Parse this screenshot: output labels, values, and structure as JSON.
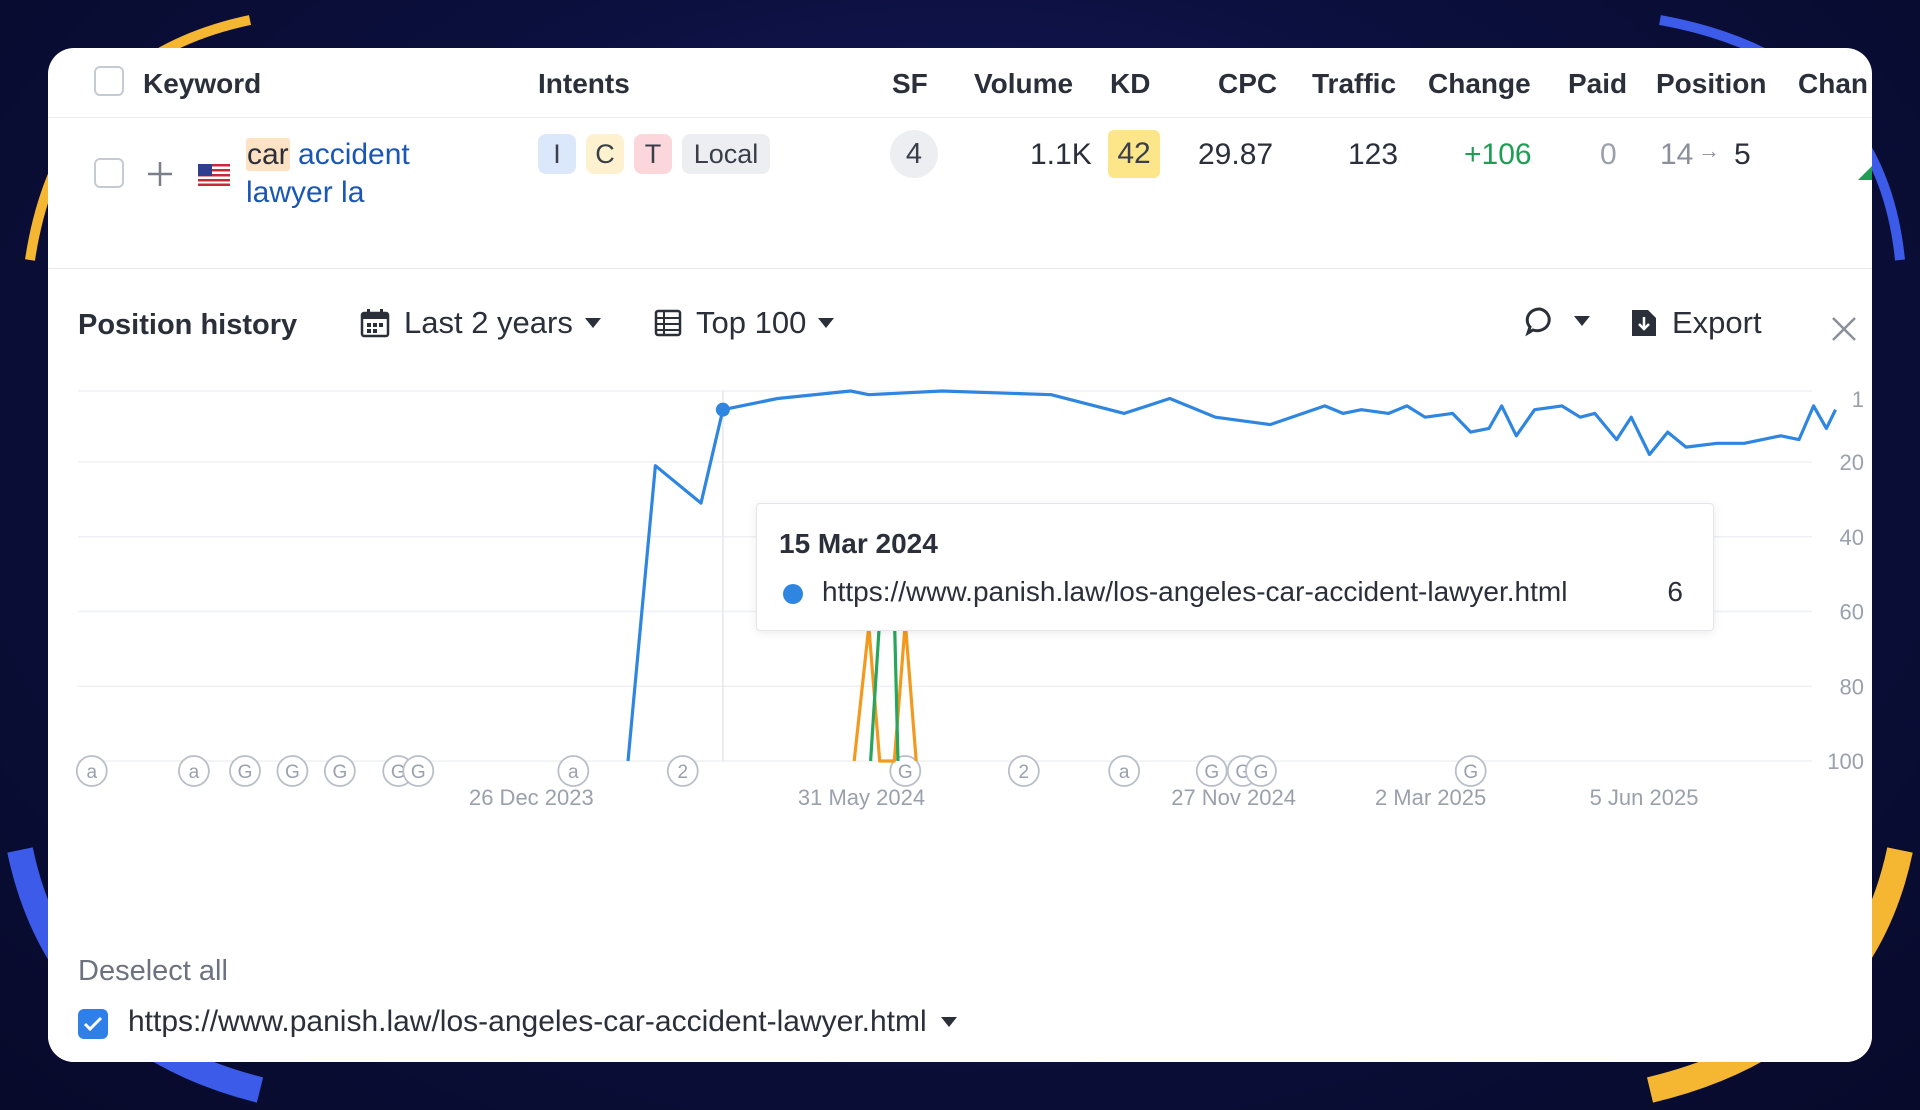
{
  "table": {
    "headers": {
      "keyword": "Keyword",
      "intents": "Intents",
      "sf": "SF",
      "volume": "Volume",
      "kd": "KD",
      "cpc": "CPC",
      "traffic": "Traffic",
      "change": "Change",
      "paid": "Paid",
      "position": "Position",
      "change2": "Chan"
    },
    "row": {
      "keyword_highlight": "car",
      "keyword_rest_line1": " accident",
      "keyword_line2": "lawyer la",
      "intents": [
        "I",
        "C",
        "T",
        "Local"
      ],
      "sf": "4",
      "volume": "1.1K",
      "kd": "42",
      "cpc": "29.87",
      "traffic": "123",
      "change": "+106",
      "paid": "0",
      "position_from": "14",
      "position_arrow": "→",
      "position_to": "5"
    }
  },
  "history": {
    "title": "Position history",
    "period": "Last 2 years",
    "top": "Top 100",
    "export": "Export",
    "deselect_all": "Deselect all",
    "url": "https://www.panish.law/los-angeles-car-accident-lawyer.html"
  },
  "tooltip": {
    "date": "15 Mar 2024",
    "url": "https://www.panish.law/los-angeles-car-accident-lawyer.html",
    "value": "6"
  },
  "colors": {
    "accent_blue": "#2f86e0",
    "kd_yellow": "#fde68a",
    "change_green": "#1f9d55",
    "orange_series": "#f39a1e",
    "green_series": "#2aa55c"
  },
  "chart_data": {
    "type": "line",
    "y_reversed": true,
    "ylim": [
      1,
      100
    ],
    "y_ticks": [
      "1",
      "20",
      "40",
      "60",
      "80",
      "100"
    ],
    "x_labels": [
      "26 Dec 2023",
      "31 May 2024",
      "27 Nov 2024",
      "2 Mar 2025",
      "5 Jun 2025"
    ],
    "serp_markers": [
      "a",
      "a",
      "G",
      "G",
      "G",
      "G",
      "G",
      "a",
      "2",
      "G",
      "2",
      "a",
      "G",
      "G",
      "G",
      "G"
    ],
    "series": [
      {
        "name": "https://www.panish.law/los-angeles-car-accident-lawyer.html",
        "color": "#2f86e0",
        "points": [
          [
            0.318,
            100
          ],
          [
            0.333,
            21
          ],
          [
            0.358,
            31
          ],
          [
            0.37,
            6
          ],
          [
            0.4,
            3
          ],
          [
            0.44,
            1
          ],
          [
            0.45,
            2
          ],
          [
            0.49,
            1
          ],
          [
            0.55,
            2
          ],
          [
            0.59,
            7
          ],
          [
            0.615,
            3
          ],
          [
            0.64,
            8
          ],
          [
            0.67,
            10
          ],
          [
            0.7,
            5
          ],
          [
            0.71,
            7
          ],
          [
            0.72,
            6
          ],
          [
            0.735,
            7
          ],
          [
            0.745,
            5
          ],
          [
            0.755,
            8
          ],
          [
            0.77,
            7
          ],
          [
            0.78,
            12
          ],
          [
            0.79,
            11
          ],
          [
            0.797,
            5
          ],
          [
            0.805,
            13
          ],
          [
            0.815,
            6
          ],
          [
            0.83,
            5
          ],
          [
            0.84,
            8
          ],
          [
            0.848,
            7
          ],
          [
            0.86,
            14
          ],
          [
            0.868,
            8
          ],
          [
            0.878,
            18
          ],
          [
            0.888,
            12
          ],
          [
            0.898,
            16
          ],
          [
            0.915,
            15
          ],
          [
            0.93,
            15
          ],
          [
            0.95,
            13
          ],
          [
            0.96,
            14
          ],
          [
            0.968,
            5
          ],
          [
            0.975,
            11
          ],
          [
            0.98,
            6
          ]
        ]
      },
      {
        "name": "orange",
        "color": "#f39a1e",
        "points": [
          [
            0.442,
            100
          ],
          [
            0.45,
            64
          ],
          [
            0.456,
            100
          ],
          [
            0.464,
            100
          ],
          [
            0.47,
            63
          ],
          [
            0.476,
            100
          ]
        ]
      },
      {
        "name": "green",
        "color": "#2aa55c",
        "points": [
          [
            0.451,
            100
          ],
          [
            0.456,
            62
          ],
          [
            0.464,
            60
          ],
          [
            0.466,
            100
          ]
        ]
      }
    ]
  }
}
